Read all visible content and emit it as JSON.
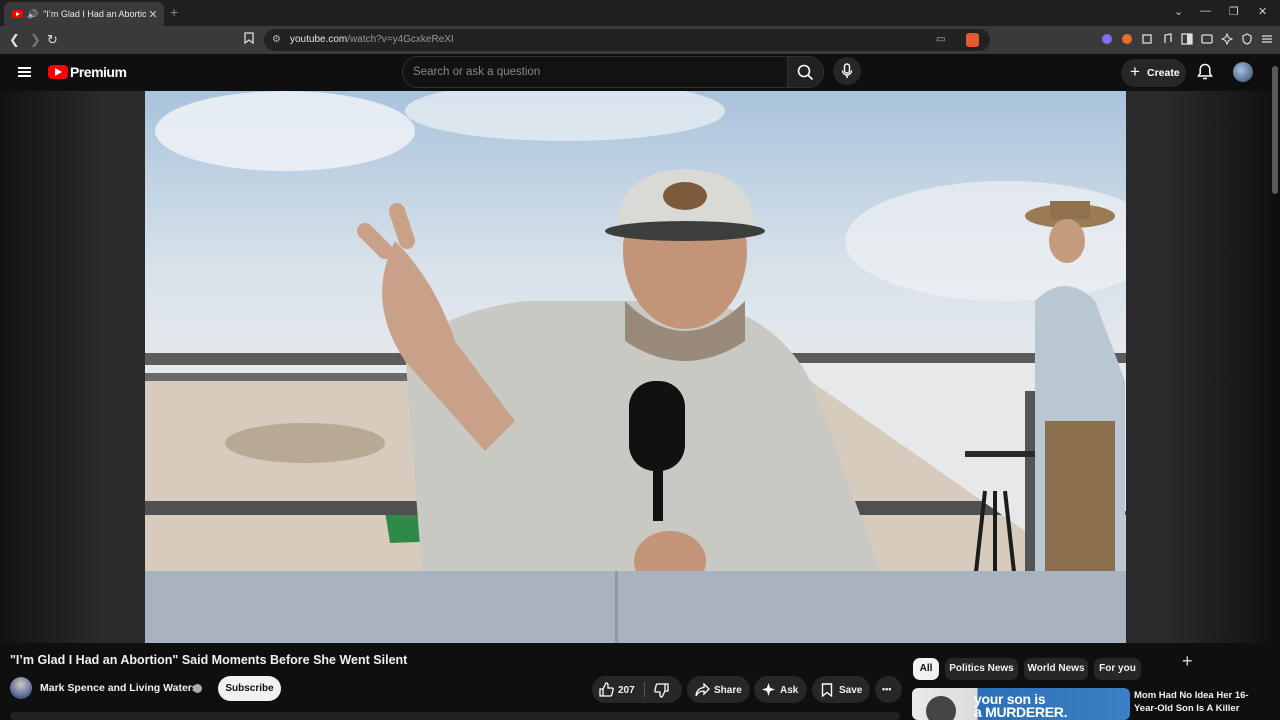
{
  "browser": {
    "tab_title": "\"I’m Glad I Had an Abortion\"",
    "new_tab": "+",
    "url_host": "youtube.com",
    "url_path": "/watch?v=y4GcxkeReXI"
  },
  "youtube": {
    "brand": "Premium",
    "search_placeholder": "Search or ask a question",
    "create_label": "Create",
    "video_title": "\"I’m Glad I Had an Abortion\" Said Moments Before She Went Silent",
    "channel_name": "Mark Spence and Living Waters",
    "subscribe_label": "Subscribe",
    "likes": "207",
    "share_label": "Share",
    "ask_label": "Ask",
    "save_label": "Save",
    "more_label": "•••"
  },
  "chips": [
    "All",
    "Politics News",
    "World News",
    "For you"
  ],
  "recommended": {
    "thumb_text_line1": "your son is",
    "thumb_text_line2": "a MURDERER.",
    "title": "Mom Had No Idea Her 16-Year-Old Son Is A Killer"
  },
  "colors": {
    "yt_red": "#ff0000",
    "background": "#0f0f0f",
    "pill": "#272727"
  }
}
